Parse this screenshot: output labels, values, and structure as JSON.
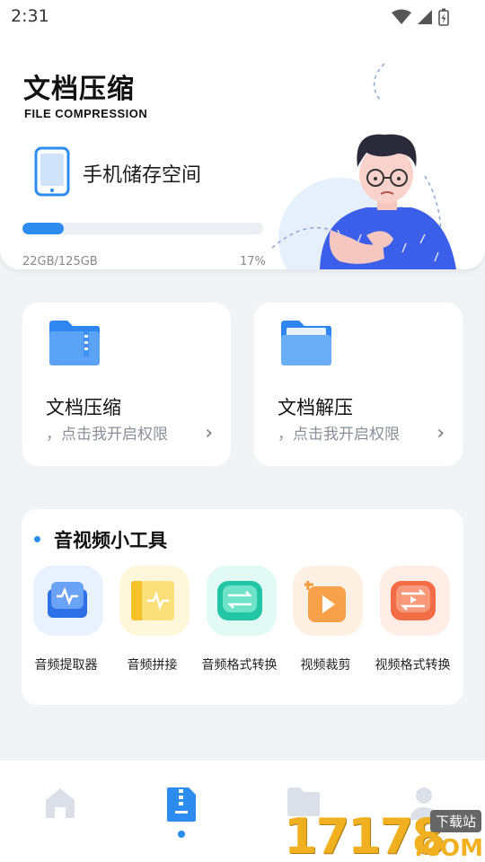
{
  "status_bar": {
    "time": "2:31"
  },
  "hero": {
    "title": "文档压缩",
    "subtitle": "FILE COMPRESSION",
    "storage_label": "手机储存空间",
    "storage_size": "22GB/125GB",
    "storage_percent": "17%",
    "usage_fraction": 0.17
  },
  "cards": [
    {
      "title": "文档压缩",
      "hint": "，点击我开启权限",
      "icon": "zip-folder-icon"
    },
    {
      "title": "文档解压",
      "hint": "，点击我开启权限",
      "icon": "open-folder-icon"
    }
  ],
  "tools": {
    "heading": "音视频小工具",
    "items": [
      {
        "label": "音频提取器",
        "icon": "audio-extract-icon",
        "color": "#e9f1ff"
      },
      {
        "label": "音频拼接",
        "icon": "audio-merge-icon",
        "color": "#fff7d9"
      },
      {
        "label": "音频格式转换",
        "icon": "audio-convert-icon",
        "color": "#e2faf4"
      },
      {
        "label": "视频裁剪",
        "icon": "video-crop-icon",
        "color": "#fff0e4"
      },
      {
        "label": "视频格式转换",
        "icon": "video-convert-icon",
        "color": "#ffede6"
      }
    ]
  },
  "bottom_nav": {
    "items": [
      "home-icon",
      "zip-file-icon",
      "folder-icon",
      "profile-icon"
    ],
    "active_index": 1
  },
  "watermark": {
    "number": "17178",
    "tag": "下载站",
    "suffix": ".COM"
  },
  "colors": {
    "accent": "#2d8cf0",
    "background": "#f1f3f7"
  }
}
